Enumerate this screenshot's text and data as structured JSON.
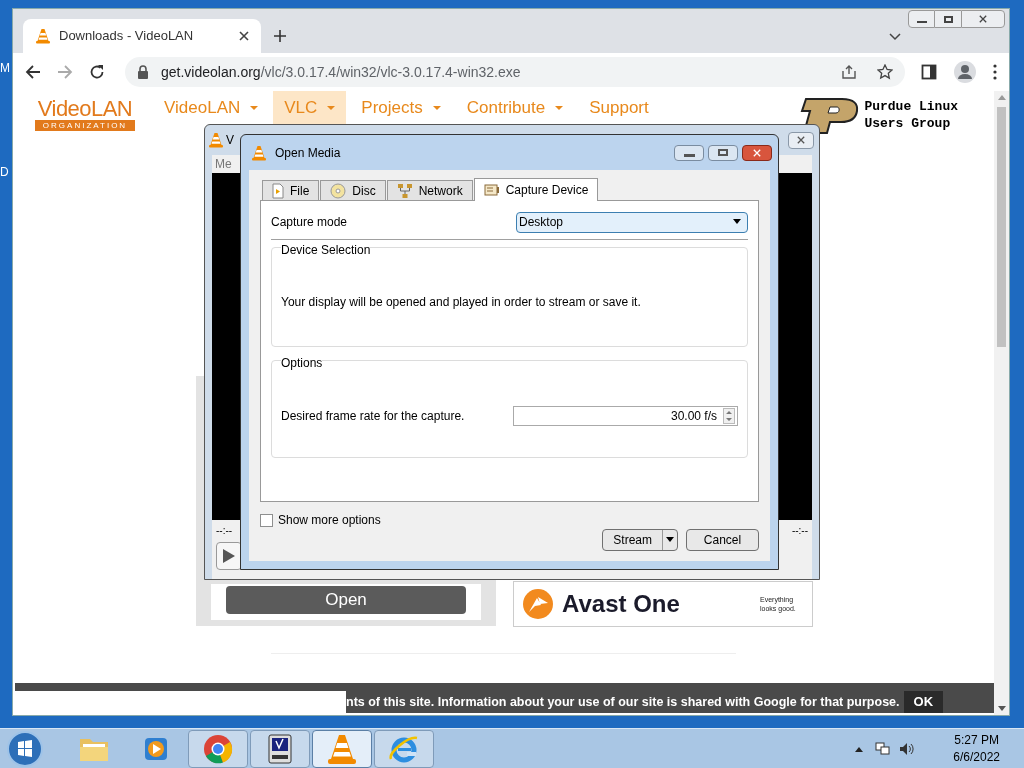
{
  "desktop_labels": [
    "M",
    "D"
  ],
  "browser": {
    "tab_title": "Downloads - VideoLAN",
    "url_host": "get.videolan.org",
    "url_path": "/vlc/3.0.17.4/win32/vlc-3.0.17.4-win32.exe"
  },
  "site": {
    "logo": {
      "name": "VideoLAN",
      "sub": "ORGANIZATION"
    },
    "nav": [
      {
        "label": "VideoLAN",
        "selected": false,
        "menu": true
      },
      {
        "label": "VLC",
        "selected": true,
        "menu": true
      },
      {
        "label": "Projects",
        "selected": false,
        "menu": true
      },
      {
        "label": "Contribute",
        "selected": false,
        "menu": true
      },
      {
        "label": "Support",
        "selected": false,
        "menu": false
      }
    ],
    "partner": [
      "Purdue Linux",
      "Users Group"
    ],
    "open_button": "Open",
    "ad": {
      "brand": "Avast One",
      "tagline": "Everything looks good."
    },
    "cookie": {
      "text": "nts of this site. Information about your use of our site is shared with Google for that purpose.",
      "button": "OK"
    }
  },
  "player": {
    "title": "V",
    "menu": "Me",
    "time_left": "--:--",
    "time_right": "--:--"
  },
  "dialog": {
    "title": "Open Media",
    "tabs": [
      {
        "label": "File",
        "selected": false
      },
      {
        "label": "Disc",
        "selected": false
      },
      {
        "label": "Network",
        "selected": false
      },
      {
        "label": "Capture Device",
        "selected": true
      }
    ],
    "capture_mode_label": "Capture mode",
    "capture_mode_value": "Desktop",
    "device_group": {
      "title": "Device Selection",
      "text": "Your display will be opened and played in order to stream or save it."
    },
    "options_group": {
      "title": "Options",
      "frame_rate_label": "Desired frame rate for the capture.",
      "frame_rate_value": "30.00 f/s"
    },
    "show_more": {
      "label": "Show more options",
      "checked": false
    },
    "stream_button": "Stream",
    "cancel_button": "Cancel"
  },
  "taskbar": {
    "apps": [
      {
        "kind": "folder",
        "selected": false
      },
      {
        "kind": "player",
        "selected": false
      },
      {
        "kind": "chrome",
        "selected": false
      },
      {
        "kind": "terminal",
        "selected": false
      },
      {
        "kind": "vlc",
        "selected": true
      },
      {
        "kind": "ie",
        "selected": false
      }
    ],
    "time": "5:27 PM",
    "date": "6/6/2022"
  }
}
